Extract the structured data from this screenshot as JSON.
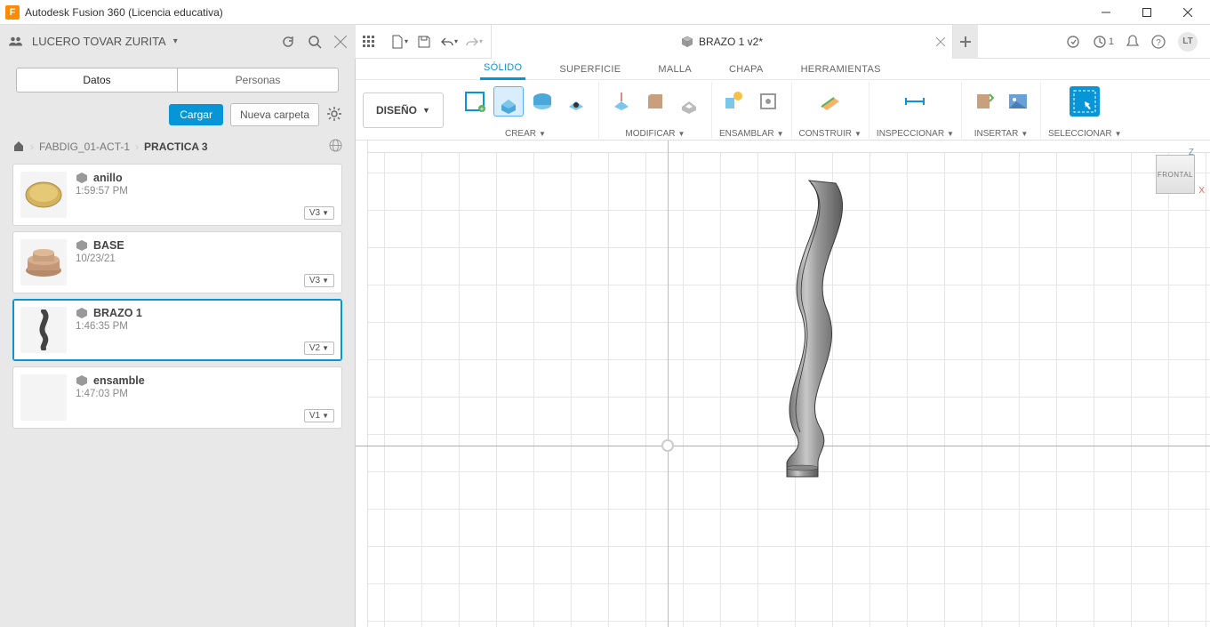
{
  "app": {
    "title": "Autodesk Fusion 360 (Licencia educativa)",
    "logo_letter": "F"
  },
  "user": {
    "name": "LUCERO TOVAR ZURITA",
    "avatar_initials": "LT"
  },
  "clock_badge_count": "1",
  "doc_tab": {
    "title": "BRAZO 1 v2*"
  },
  "panel": {
    "tabs": {
      "data": "Datos",
      "people": "Personas"
    },
    "actions": {
      "upload": "Cargar",
      "new_folder": "Nueva carpeta"
    }
  },
  "breadcrumb": {
    "project": "FABDIG_01-ACT-1",
    "folder": "PRACTICA 3"
  },
  "files": [
    {
      "name": "anillo",
      "time": "1:59:57 PM",
      "version": "V3",
      "selected": false,
      "thumb": "ring"
    },
    {
      "name": "BASE",
      "time": "10/23/21",
      "version": "V3",
      "selected": false,
      "thumb": "base"
    },
    {
      "name": "BRAZO 1",
      "time": "1:46:35 PM",
      "version": "V2",
      "selected": true,
      "thumb": "arm"
    },
    {
      "name": "ensamble",
      "time": "1:47:03 PM",
      "version": "V1",
      "selected": false,
      "thumb": "none"
    }
  ],
  "ribbon": {
    "design_btn": "DISEÑO",
    "tabs": {
      "solid": "SÓLIDO",
      "surface": "SUPERFICIE",
      "mesh": "MALLA",
      "sheet": "CHAPA",
      "tools": "HERRAMIENTAS"
    },
    "groups": {
      "create": "CREAR",
      "modify": "MODIFICAR",
      "assemble": "ENSAMBLAR",
      "construct": "CONSTRUIR",
      "inspect": "INSPECCIONAR",
      "insert": "INSERTAR",
      "select": "SELECCIONAR"
    }
  },
  "viewcube": {
    "face": "FRONTAL",
    "z": "Z",
    "x": "X"
  }
}
